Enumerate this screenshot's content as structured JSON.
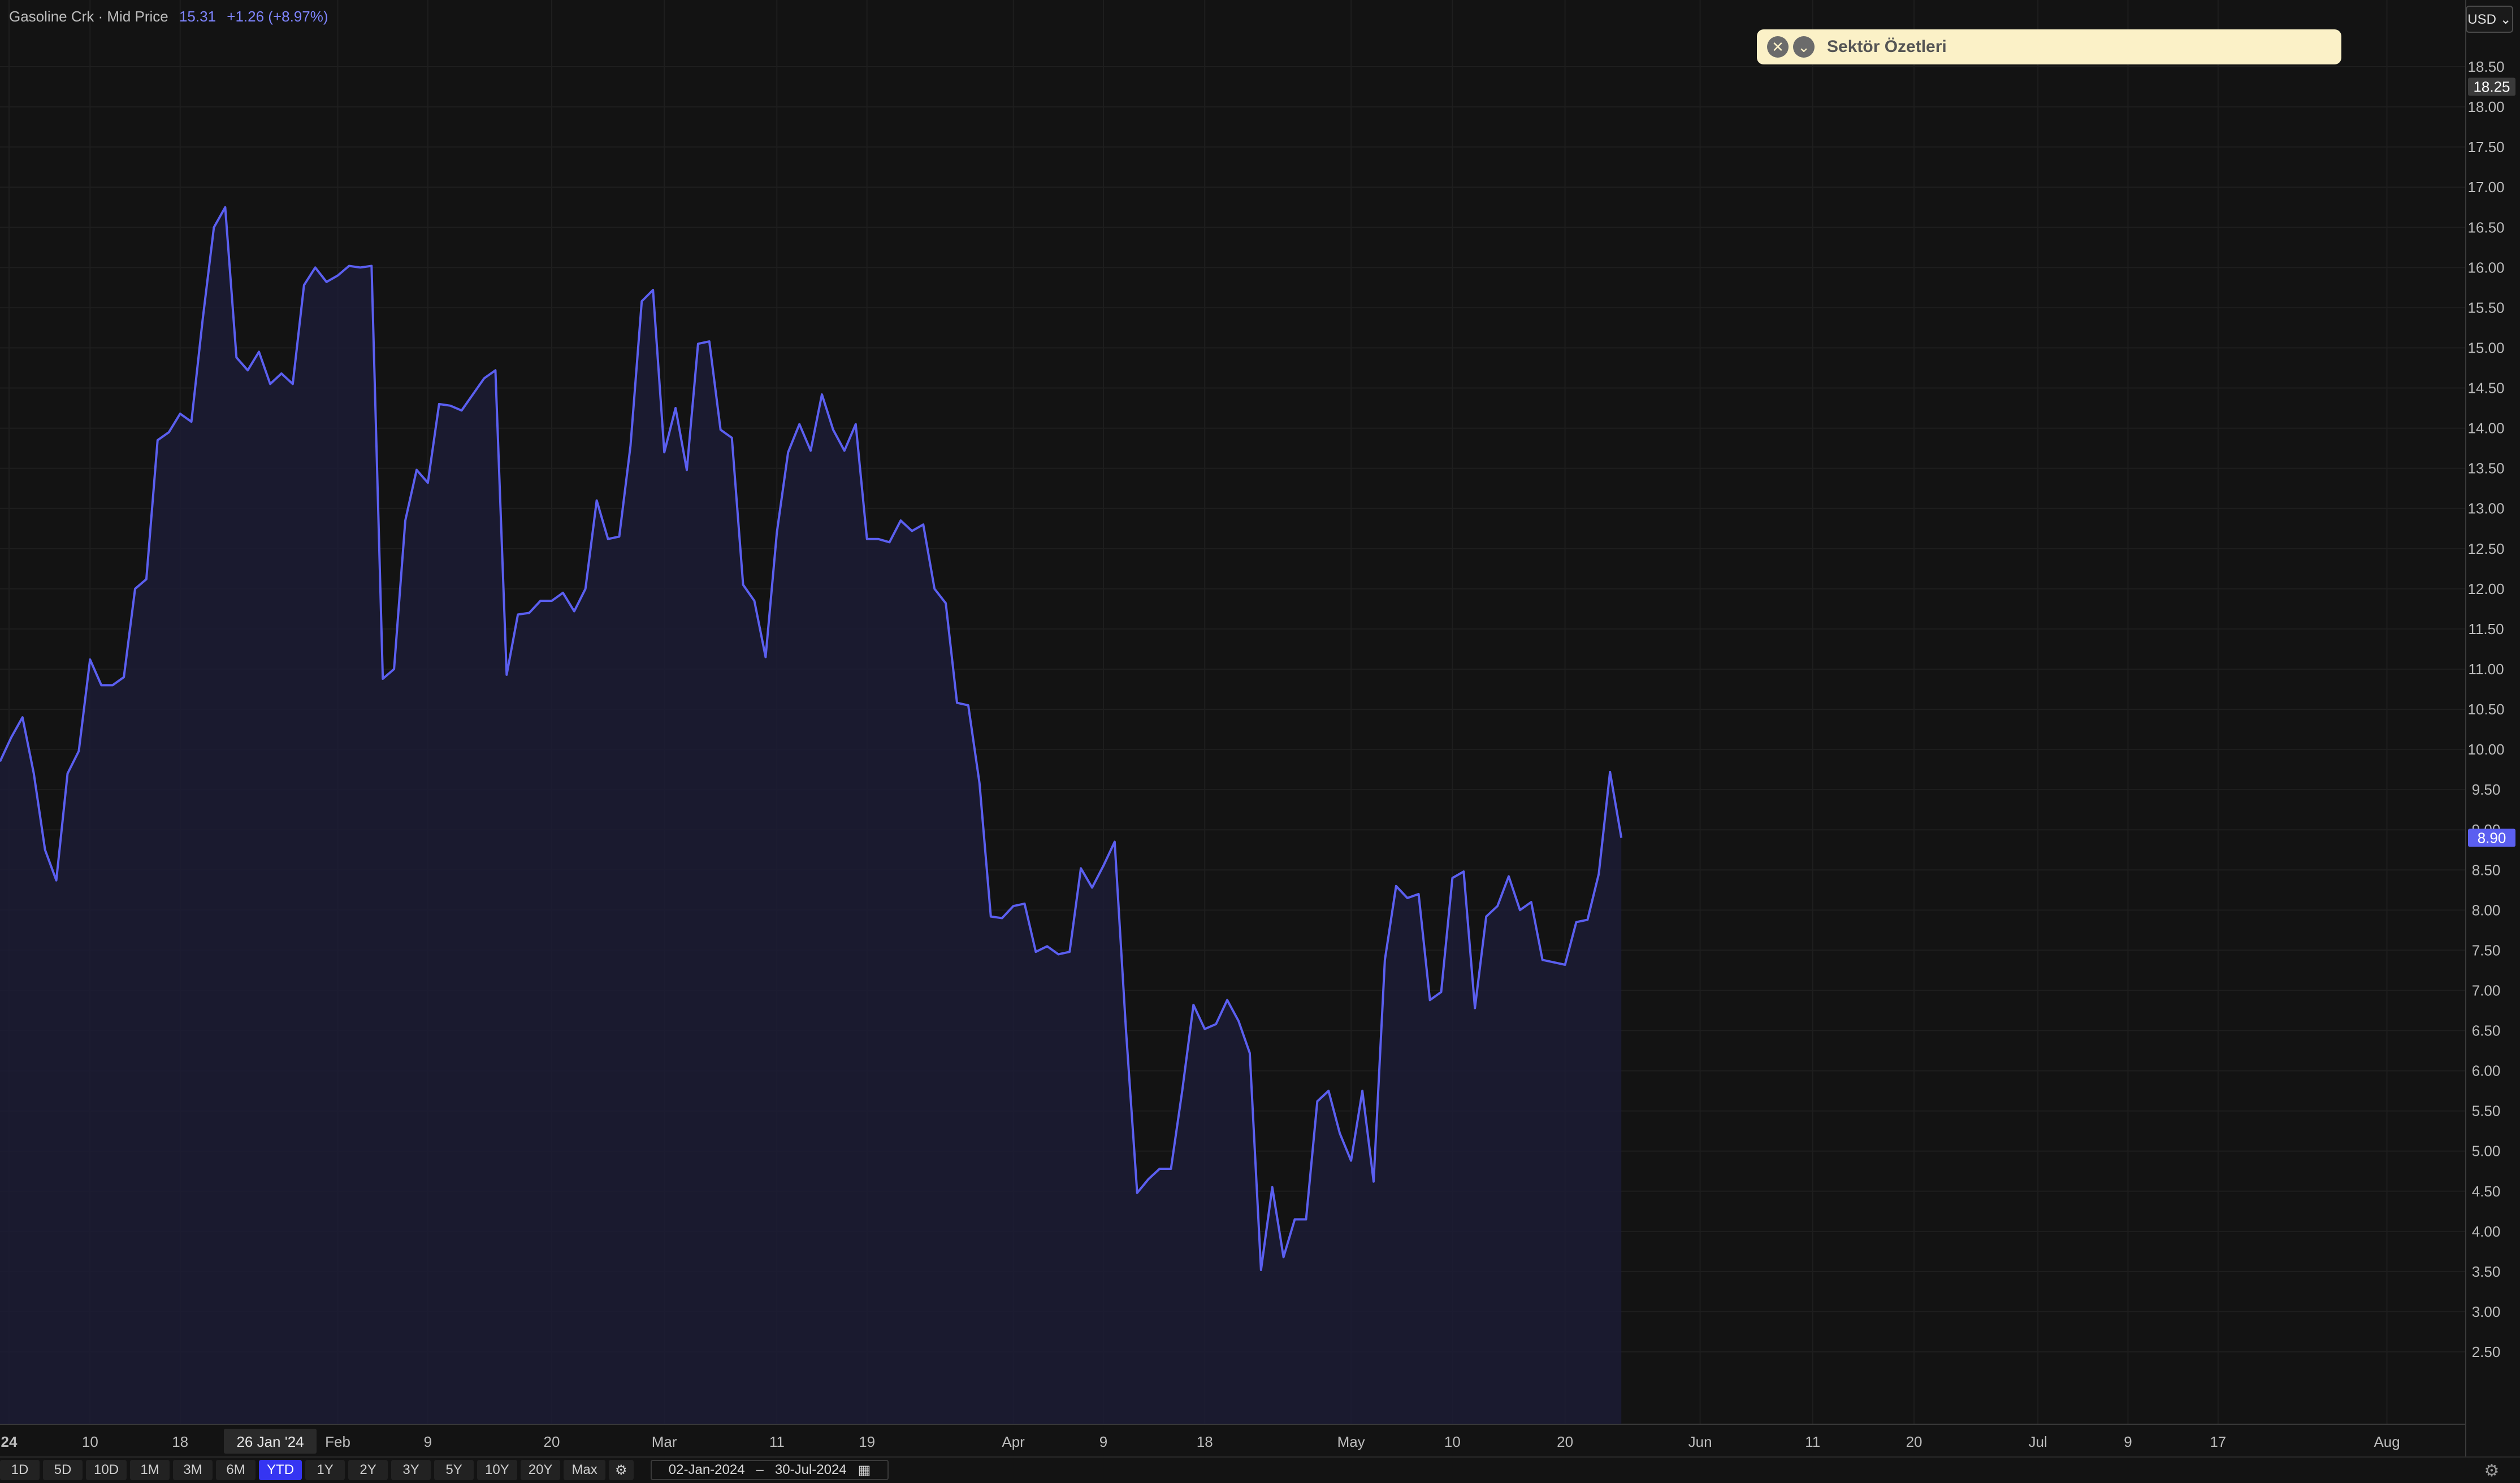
{
  "legend": {
    "name": "Gasoline Crk · Mid Price",
    "value": "15.31",
    "change": "+1.26 (+8.97%)"
  },
  "currency_button": "USD ⌄",
  "banner": {
    "label": "Sektör Özetleri",
    "close_icon": "close-icon",
    "chevron_icon": "chevron-down-icon"
  },
  "range_buttons": [
    "1D",
    "5D",
    "10D",
    "1M",
    "3M",
    "6M",
    "YTD",
    "1Y",
    "2Y",
    "3Y",
    "5Y",
    "10Y",
    "20Y",
    "Max"
  ],
  "active_range": "YTD",
  "date_range": {
    "start": "02-Jan-2024",
    "sep": "–",
    "end": "30-Jul-2024"
  },
  "colors": {
    "line": "#5b5ff0",
    "fill": "#1c1c35",
    "background": "#131313",
    "grid": "#1e1e1e",
    "axis_text": "#bdbdbd"
  },
  "chart_data": {
    "type": "area",
    "ylim": [
      2.0,
      18.8
    ],
    "yticks": [
      2.5,
      3.0,
      3.5,
      4.0,
      4.5,
      5.0,
      5.5,
      6.0,
      6.5,
      7.0,
      7.5,
      8.0,
      8.5,
      9.0,
      9.5,
      10.0,
      10.5,
      11.0,
      11.5,
      12.0,
      12.5,
      13.0,
      13.5,
      14.0,
      14.5,
      15.0,
      15.5,
      16.0,
      16.5,
      17.0,
      17.5,
      18.0,
      18.5
    ],
    "xlim": [
      "2024-01-02",
      "2024-08-08"
    ],
    "x_tick_labels": [
      {
        "date": "2024-01-01",
        "label": "24"
      },
      {
        "date": "2024-01-10",
        "label": "10"
      },
      {
        "date": "2024-01-18",
        "label": "18"
      },
      {
        "date": "2024-02-01",
        "label": "Feb"
      },
      {
        "date": "2024-02-09",
        "label": "9"
      },
      {
        "date": "2024-02-20",
        "label": "20"
      },
      {
        "date": "2024-03-01",
        "label": "Mar"
      },
      {
        "date": "2024-03-11",
        "label": "11"
      },
      {
        "date": "2024-03-19",
        "label": "19"
      },
      {
        "date": "2024-04-01",
        "label": "Apr"
      },
      {
        "date": "2024-04-09",
        "label": "9"
      },
      {
        "date": "2024-04-18",
        "label": "18"
      },
      {
        "date": "2024-05-01",
        "label": "May"
      },
      {
        "date": "2024-05-10",
        "label": "10"
      },
      {
        "date": "2024-05-20",
        "label": "20"
      },
      {
        "date": "2024-06-01",
        "label": "Jun"
      },
      {
        "date": "2024-06-11",
        "label": "11"
      },
      {
        "date": "2024-06-20",
        "label": "20"
      },
      {
        "date": "2024-07-01",
        "label": "Jul"
      },
      {
        "date": "2024-07-09",
        "label": "9"
      },
      {
        "date": "2024-07-17",
        "label": "17"
      },
      {
        "date": "2024-08-01",
        "label": "Aug"
      }
    ],
    "crosshair_x_label": {
      "date": "2024-01-26",
      "label": "26 Jan '24"
    },
    "price_labels": [
      {
        "value": 18.25,
        "label": "18.25",
        "style": "marker"
      },
      {
        "value": 8.9,
        "label": "8.90",
        "style": "last"
      }
    ],
    "series": [
      {
        "points": [
          [
            "2024-01-02",
            9.85
          ],
          [
            "2024-01-03",
            10.15
          ],
          [
            "2024-01-04",
            10.4
          ],
          [
            "2024-01-05",
            9.7
          ],
          [
            "2024-01-06",
            8.75
          ],
          [
            "2024-01-07",
            8.37
          ],
          [
            "2024-01-08",
            9.7
          ],
          [
            "2024-01-09",
            9.98
          ],
          [
            "2024-01-10",
            11.12
          ],
          [
            "2024-01-11",
            10.8
          ],
          [
            "2024-01-12",
            10.8
          ],
          [
            "2024-01-13",
            10.9
          ],
          [
            "2024-01-14",
            12.0
          ],
          [
            "2024-01-15",
            12.12
          ],
          [
            "2024-01-16",
            13.85
          ],
          [
            "2024-01-17",
            13.95
          ],
          [
            "2024-01-18",
            14.18
          ],
          [
            "2024-01-19",
            14.08
          ],
          [
            "2024-01-20",
            15.35
          ],
          [
            "2024-01-21",
            16.5
          ],
          [
            "2024-01-22",
            16.75
          ],
          [
            "2024-01-23",
            14.88
          ],
          [
            "2024-01-24",
            14.72
          ],
          [
            "2024-01-25",
            14.95
          ],
          [
            "2024-01-26",
            14.55
          ],
          [
            "2024-01-27",
            14.68
          ],
          [
            "2024-01-28",
            14.55
          ],
          [
            "2024-01-29",
            15.78
          ],
          [
            "2024-01-30",
            16.0
          ],
          [
            "2024-01-31",
            15.82
          ],
          [
            "2024-02-01",
            15.9
          ],
          [
            "2024-02-02",
            16.02
          ],
          [
            "2024-02-03",
            16.0
          ],
          [
            "2024-02-04",
            16.02
          ],
          [
            "2024-02-05",
            10.88
          ],
          [
            "2024-02-06",
            11.0
          ],
          [
            "2024-02-07",
            12.85
          ],
          [
            "2024-02-08",
            13.48
          ],
          [
            "2024-02-09",
            13.32
          ],
          [
            "2024-02-10",
            14.3
          ],
          [
            "2024-02-11",
            14.28
          ],
          [
            "2024-02-12",
            14.22
          ],
          [
            "2024-02-13",
            14.42
          ],
          [
            "2024-02-14",
            14.62
          ],
          [
            "2024-02-15",
            14.72
          ],
          [
            "2024-02-16",
            10.93
          ],
          [
            "2024-02-17",
            11.68
          ],
          [
            "2024-02-18",
            11.7
          ],
          [
            "2024-02-19",
            11.85
          ],
          [
            "2024-02-20",
            11.85
          ],
          [
            "2024-02-21",
            11.95
          ],
          [
            "2024-02-22",
            11.72
          ],
          [
            "2024-02-23",
            12.0
          ],
          [
            "2024-02-24",
            13.1
          ],
          [
            "2024-02-25",
            12.62
          ],
          [
            "2024-02-26",
            12.65
          ],
          [
            "2024-02-27",
            13.78
          ],
          [
            "2024-02-28",
            15.58
          ],
          [
            "2024-02-29",
            15.72
          ],
          [
            "2024-03-01",
            13.7
          ],
          [
            "2024-03-02",
            14.25
          ],
          [
            "2024-03-03",
            13.48
          ],
          [
            "2024-03-04",
            15.05
          ],
          [
            "2024-03-05",
            15.08
          ],
          [
            "2024-03-06",
            13.98
          ],
          [
            "2024-03-07",
            13.88
          ],
          [
            "2024-03-08",
            12.05
          ],
          [
            "2024-03-09",
            11.85
          ],
          [
            "2024-03-10",
            11.15
          ],
          [
            "2024-03-11",
            12.7
          ],
          [
            "2024-03-12",
            13.7
          ],
          [
            "2024-03-13",
            14.05
          ],
          [
            "2024-03-14",
            13.72
          ],
          [
            "2024-03-15",
            14.42
          ],
          [
            "2024-03-16",
            13.98
          ],
          [
            "2024-03-17",
            13.72
          ],
          [
            "2024-03-18",
            14.05
          ],
          [
            "2024-03-19",
            12.62
          ],
          [
            "2024-03-20",
            12.62
          ],
          [
            "2024-03-21",
            12.58
          ],
          [
            "2024-03-22",
            12.85
          ],
          [
            "2024-03-23",
            12.72
          ],
          [
            "2024-03-24",
            12.8
          ],
          [
            "2024-03-25",
            12.0
          ],
          [
            "2024-03-26",
            11.82
          ],
          [
            "2024-03-27",
            10.58
          ],
          [
            "2024-03-28",
            10.55
          ],
          [
            "2024-03-29",
            9.58
          ],
          [
            "2024-03-30",
            7.92
          ],
          [
            "2024-03-31",
            7.9
          ],
          [
            "2024-04-01",
            8.05
          ],
          [
            "2024-04-02",
            8.08
          ],
          [
            "2024-04-03",
            7.48
          ],
          [
            "2024-04-04",
            7.55
          ],
          [
            "2024-04-05",
            7.45
          ],
          [
            "2024-04-06",
            7.48
          ],
          [
            "2024-04-07",
            8.52
          ],
          [
            "2024-04-08",
            8.28
          ],
          [
            "2024-04-09",
            8.55
          ],
          [
            "2024-04-10",
            8.85
          ],
          [
            "2024-04-11",
            6.52
          ],
          [
            "2024-04-12",
            4.48
          ],
          [
            "2024-04-13",
            4.65
          ],
          [
            "2024-04-14",
            4.78
          ],
          [
            "2024-04-15",
            4.78
          ],
          [
            "2024-04-16",
            5.75
          ],
          [
            "2024-04-17",
            6.82
          ],
          [
            "2024-04-18",
            6.52
          ],
          [
            "2024-04-19",
            6.58
          ],
          [
            "2024-04-20",
            6.88
          ],
          [
            "2024-04-21",
            6.62
          ],
          [
            "2024-04-22",
            6.22
          ],
          [
            "2024-04-23",
            3.52
          ],
          [
            "2024-04-24",
            4.55
          ],
          [
            "2024-04-25",
            3.68
          ],
          [
            "2024-04-26",
            4.15
          ],
          [
            "2024-04-27",
            4.15
          ],
          [
            "2024-04-28",
            5.62
          ],
          [
            "2024-04-29",
            5.75
          ],
          [
            "2024-04-30",
            5.22
          ],
          [
            "2024-05-01",
            4.88
          ],
          [
            "2024-05-02",
            5.75
          ],
          [
            "2024-05-03",
            4.62
          ],
          [
            "2024-05-04",
            7.38
          ],
          [
            "2024-05-05",
            8.3
          ],
          [
            "2024-05-06",
            8.15
          ],
          [
            "2024-05-07",
            8.2
          ],
          [
            "2024-05-08",
            6.88
          ],
          [
            "2024-05-09",
            6.98
          ],
          [
            "2024-05-10",
            8.4
          ],
          [
            "2024-05-11",
            8.48
          ],
          [
            "2024-05-12",
            6.78
          ],
          [
            "2024-05-13",
            7.92
          ],
          [
            "2024-05-14",
            8.05
          ],
          [
            "2024-05-15",
            8.42
          ],
          [
            "2024-05-16",
            8.0
          ],
          [
            "2024-05-17",
            8.1
          ],
          [
            "2024-05-18",
            7.38
          ],
          [
            "2024-05-19",
            7.35
          ],
          [
            "2024-05-20",
            7.32
          ],
          [
            "2024-05-21",
            7.85
          ],
          [
            "2024-05-22",
            7.88
          ],
          [
            "2024-05-23",
            8.45
          ],
          [
            "2024-05-24",
            9.72
          ],
          [
            "2024-05-25",
            8.9
          ]
        ]
      }
    ]
  }
}
